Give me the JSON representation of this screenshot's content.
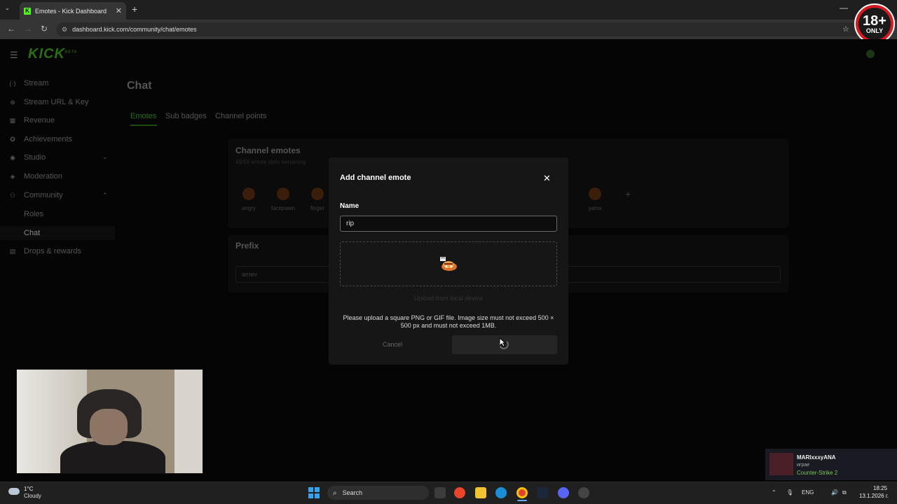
{
  "browser": {
    "tab_title": "Emotes - Kick Dashboard",
    "tab_favicon": "K",
    "url": "dashboard.kick.com/community/chat/emotes",
    "new_tab": "+",
    "close_tab": "✕",
    "minimize": "—",
    "back": "←",
    "forward": "→",
    "reload": "↻",
    "star": "☆",
    "tune": "⚙",
    "tab_menu": "⌄"
  },
  "overlay_badge": {
    "big": "18+",
    "small": "ONLY"
  },
  "logo": {
    "text": "KICK",
    "sup": "BETA"
  },
  "sidebar": {
    "items": [
      {
        "icon": "(·)",
        "label": "Stream"
      },
      {
        "icon": "⊕",
        "label": "Stream URL & Key"
      },
      {
        "icon": "▦",
        "label": "Revenue"
      },
      {
        "icon": "✪",
        "label": "Achievements"
      },
      {
        "icon": "◉",
        "label": "Studio"
      },
      {
        "icon": "◈",
        "label": "Moderation"
      },
      {
        "icon": "⚇",
        "label": "Community"
      },
      {
        "icon": "",
        "label": "Roles"
      },
      {
        "icon": "",
        "label": "Chat"
      },
      {
        "icon": "▤",
        "label": "Drops & rewards"
      }
    ],
    "chevron_down": "⌄",
    "chevron_up": "⌃"
  },
  "main": {
    "title": "Chat",
    "tabs": [
      "Emotes",
      "Sub badges",
      "Channel points"
    ],
    "channel_emotes": {
      "title": "Channel emotes",
      "subtitle": "49/50 emote slots remaining",
      "emotes": [
        "angry",
        "facepawn",
        "finger",
        "yams"
      ],
      "add": "+"
    },
    "prefix": {
      "title": "Prefix",
      "value": "amev"
    }
  },
  "modal": {
    "title": "Add channel emote",
    "close": "✕",
    "name_label": "Name",
    "name_value": "rip",
    "upload_text": "Upload from local device",
    "help_text": "Please upload a square PNG or GIF file. Image size must not exceed 500 × 500 px and must not exceed 1MB.",
    "cancel": "Cancel"
  },
  "notification": {
    "name": "MARIxxxyANA",
    "status": "играе",
    "game": "Counter-Strike 2"
  },
  "taskbar": {
    "temperature": "1°C",
    "weather": "Cloudy",
    "search": "Search",
    "search_icon": "⌕",
    "language": "ENG",
    "time": "18:25",
    "date": "13.1.2026 г.",
    "tray_up": "⌃",
    "tray_mic": "🎙",
    "tray_vol": "🔊",
    "tray_net": "⧉"
  }
}
